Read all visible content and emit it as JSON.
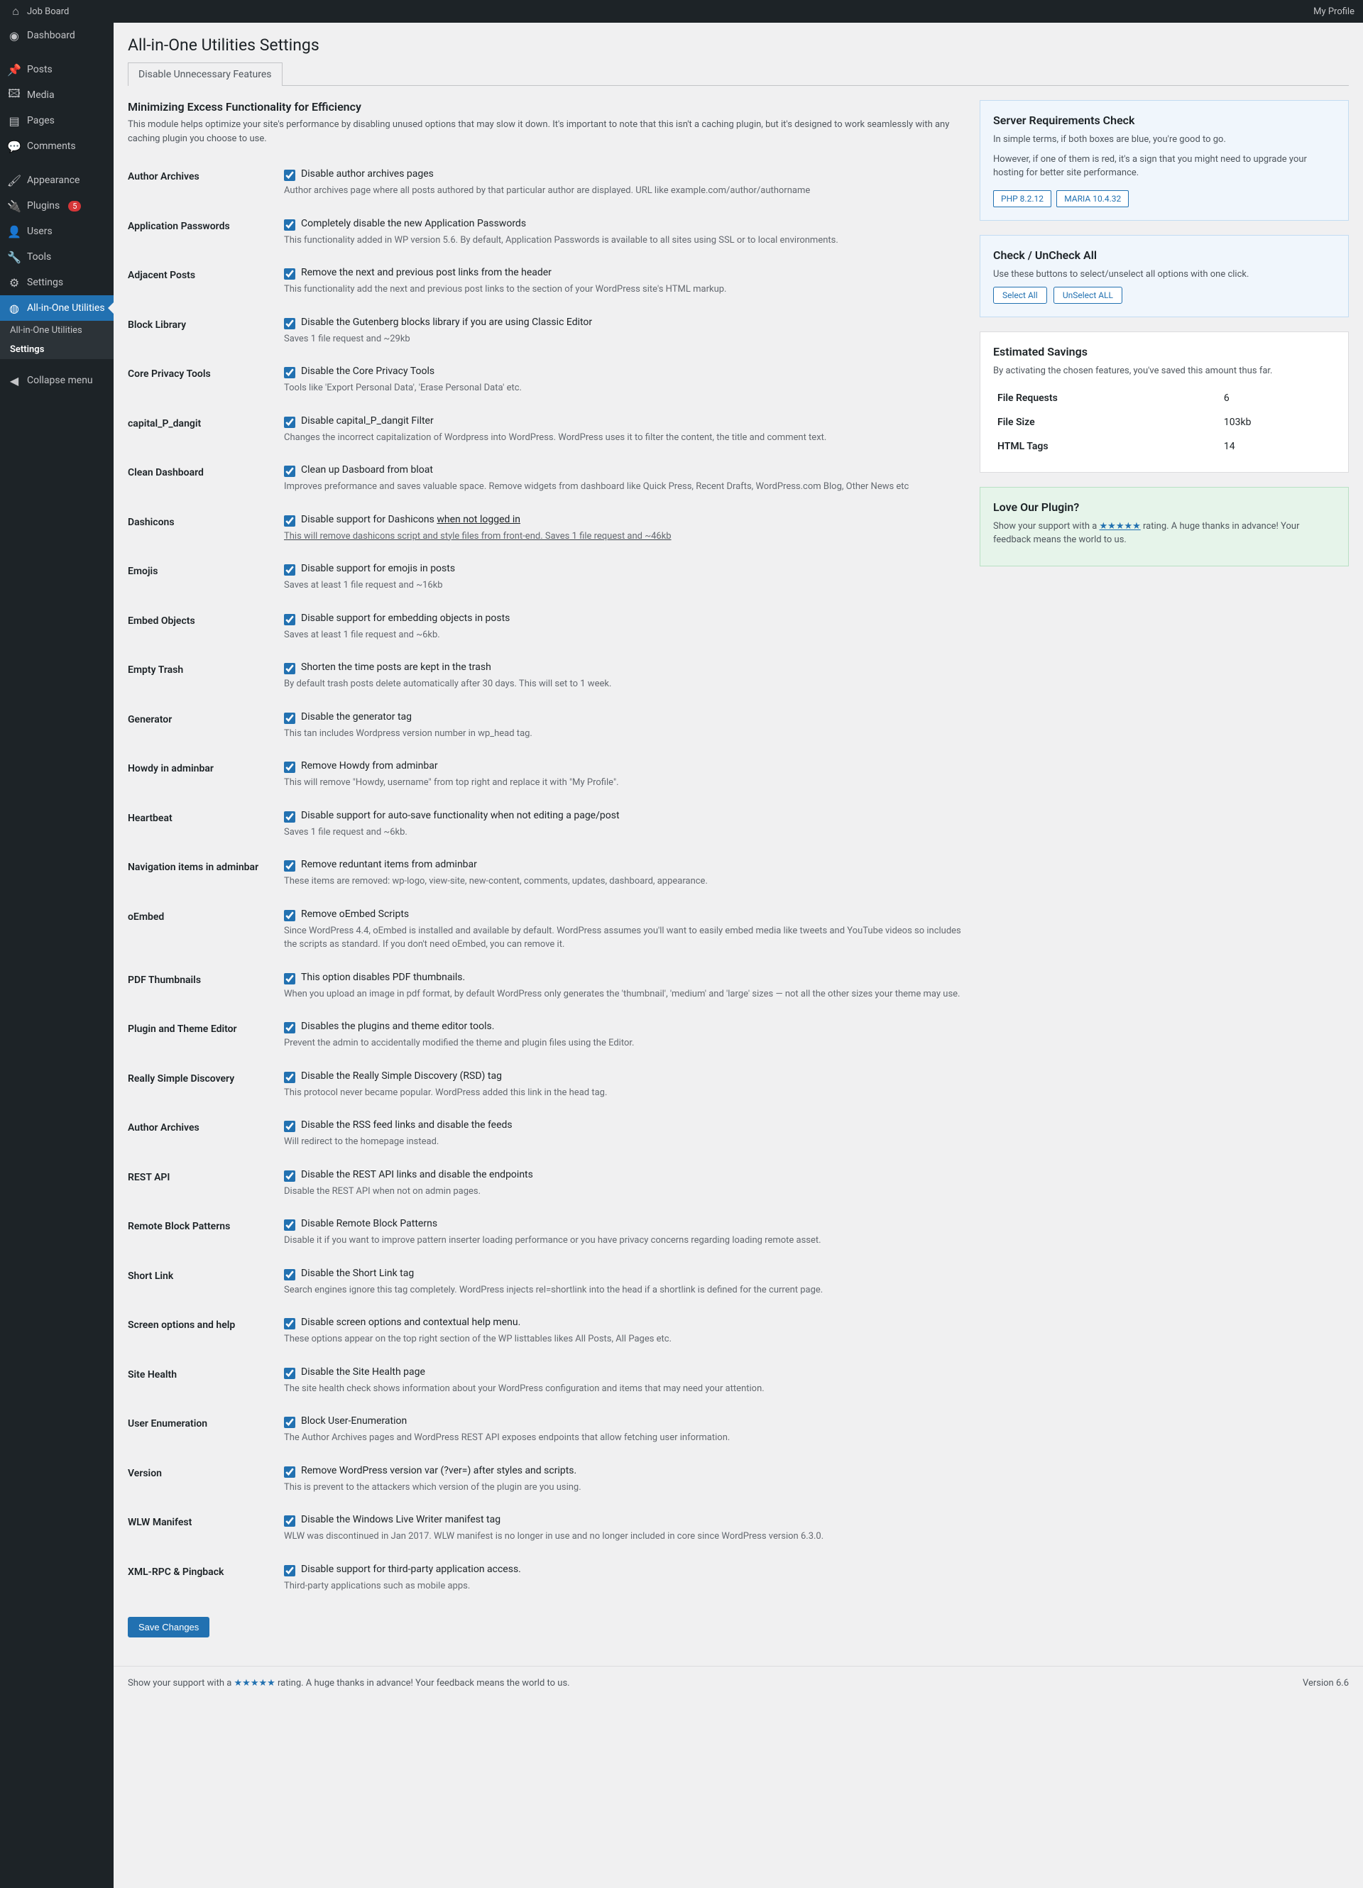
{
  "adminbar": {
    "site": "Job Board",
    "profile": "My Profile"
  },
  "menu": {
    "dashboard": "Dashboard",
    "posts": "Posts",
    "media": "Media",
    "pages": "Pages",
    "comments": "Comments",
    "appearance": "Appearance",
    "plugins": "Plugins",
    "plugins_count": "5",
    "users": "Users",
    "tools": "Tools",
    "settings": "Settings",
    "aio": "All-in-One Utilities",
    "sub_aio": "All-in-One Utilities",
    "sub_settings": "Settings",
    "collapse": "Collapse menu"
  },
  "page": {
    "title": "All-in-One Utilities Settings",
    "tab": "Disable Unnecessary Features",
    "intro_h": "Minimizing Excess Functionality for Efficiency",
    "intro_p": "This module helps optimize your site's performance by disabling unused options that may slow it down. It's important to note that this isn't a caching plugin, but it's designed to work seamlessly with any caching plugin you choose to use.",
    "save": "Save Changes"
  },
  "opts": [
    {
      "th": "Author Archives",
      "lbl": "Disable author archives pages",
      "desc": "Author archives page where all posts authored by that particular author are displayed. URL like example.com/author/authorname"
    },
    {
      "th": "Application Passwords",
      "lbl": "Completely disable the new Application Passwords",
      "desc": "This functionality added in WP version 5.6. By default, Application Passwords is available to all sites using SSL or to local environments."
    },
    {
      "th": "Adjacent Posts",
      "lbl": "Remove the next and previous post links from the header",
      "desc": "This functionality add the next and previous post links to the <head> section of your WordPress site's HTML markup."
    },
    {
      "th": "Block Library",
      "lbl": "Disable the Gutenberg blocks library if you are using Classic Editor",
      "desc": "Saves 1 file request and ~29kb"
    },
    {
      "th": "Core Privacy Tools",
      "lbl": "Disable the Core Privacy Tools",
      "desc": "Tools like 'Export Personal Data', 'Erase Personal Data' etc."
    },
    {
      "th": "capital_P_dangit",
      "lbl": "Disable capital_P_dangit Filter",
      "desc": "Changes the incorrect capitalization of Wordpress into WordPress. WordPress uses it to filter the content, the title and comment text."
    },
    {
      "th": "Clean Dashboard",
      "lbl": "Clean up Dasboard from bloat",
      "desc": "Improves preformance and saves valuable space. Remove widgets from dashboard like Quick Press, Recent Drafts, WordPress.com Blog, Other News etc"
    },
    {
      "th": "Dashicons",
      "lbl": "Disable support for Dashicons <u>when not logged in",
      "desc": "This will remove dashicons script and style files from front-end. Saves 1 file request and ~46kb"
    },
    {
      "th": "Emojis",
      "lbl": "Disable support for emojis in posts",
      "desc": "Saves at least 1 file request and ~16kb"
    },
    {
      "th": "Embed Objects",
      "lbl": "Disable support for embedding objects in posts",
      "desc": "Saves at least 1 file request and ~6kb."
    },
    {
      "th": "Empty Trash",
      "lbl": "Shorten the time posts are kept in the trash",
      "desc": "By default trash posts delete automatically after 30 days. This will set to 1 week."
    },
    {
      "th": "Generator",
      "lbl": "Disable the generator tag",
      "desc": "This tan includes Wordpress version number in wp_head tag."
    },
    {
      "th": "Howdy in adminbar",
      "lbl": "Remove Howdy from adminbar",
      "desc": "This will remove \"Howdy, username\" from top right and replace it with \"My Profile\"."
    },
    {
      "th": "Heartbeat",
      "lbl": "Disable support for auto-save functionality when not editing a page/post",
      "desc": "Saves 1 file request and ~6kb."
    },
    {
      "th": "Navigation items in adminbar",
      "lbl": "Remove reduntant items from adminbar",
      "desc": "These items are removed: wp-logo, view-site, new-content, comments, updates, dashboard, appearance."
    },
    {
      "th": "oEmbed",
      "lbl": "Remove oEmbed Scripts",
      "desc": "Since WordPress 4.4, oEmbed is installed and available by default. WordPress assumes you'll want to easily embed media like tweets and YouTube videos so includes the scripts as standard. If you don't need oEmbed, you can remove it."
    },
    {
      "th": "PDF Thumbnails",
      "lbl": "This option disables PDF thumbnails.",
      "desc": "When you upload an image in pdf format, by default WordPress only generates the 'thumbnail', 'medium' and 'large' sizes — not all the other sizes your theme may use."
    },
    {
      "th": "Plugin and Theme Editor",
      "lbl": "Disables the plugins and theme editor tools.",
      "desc": "Prevent the admin to accidentally modified the theme and plugin files using the Editor."
    },
    {
      "th": "Really Simple Discovery",
      "lbl": "Disable the Really Simple Discovery (RSD) tag",
      "desc": "This protocol never became popular. WordPress added this link in the head tag."
    },
    {
      "th": "Author Archives",
      "lbl": "Disable the RSS feed links and disable the feeds",
      "desc": "Will redirect to the homepage instead."
    },
    {
      "th": "REST API",
      "lbl": "Disable the REST API links and disable the endpoints",
      "desc": "Disable the REST API when not on admin pages."
    },
    {
      "th": "Remote Block Patterns",
      "lbl": "Disable Remote Block Patterns",
      "desc": "Disable it if you want to improve pattern inserter loading performance or you have privacy concerns regarding loading remote asset."
    },
    {
      "th": "Short Link",
      "lbl": "Disable the Short Link tag",
      "desc": "Search engines ignore this tag completely. WordPress injects rel=shortlink into the head if a shortlink is defined for the current page."
    },
    {
      "th": "Screen options and help",
      "lbl": "Disable screen options and contextual help menu.",
      "desc": "These options appear on the top right section of the WP listtables likes All Posts, All Pages etc."
    },
    {
      "th": "Site Health",
      "lbl": "Disable the Site Health page",
      "desc": "The site health check shows information about your WordPress configuration and items that may need your attention."
    },
    {
      "th": "User Enumeration",
      "lbl": "Block User-Enumeration",
      "desc": "The Author Archives pages and WordPress REST API exposes endpoints that allow fetching user information."
    },
    {
      "th": "Version",
      "lbl": "Remove WordPress version var (?ver=) after styles and scripts.",
      "desc": "This is prevent to the attackers which version of the plugin are you using."
    },
    {
      "th": "WLW Manifest",
      "lbl": "Disable the Windows Live Writer manifest tag",
      "desc": "WLW was discontinued in Jan 2017. WLW manifest is no longer in use and no longer included in core since WordPress version 6.3.0."
    },
    {
      "th": "XML-RPC & Pingback",
      "lbl": "Disable support for third-party application access.",
      "desc": "Third-party applications such as mobile apps."
    }
  ],
  "side": {
    "req_h": "Server Requirements Check",
    "req_p1": "In simple terms, if both boxes are blue, you're good to go.",
    "req_p2": "However, if one of them is red, it's a sign that you might need to upgrade your hosting for better site performance.",
    "req_php": "PHP 8.2.12",
    "req_db": "MARIA 10.4.32",
    "chk_h": "Check / UnCheck All",
    "chk_p": "Use these buttons to select/unselect all options with one click.",
    "sel": "Select All",
    "unsel": "UnSelect ALL",
    "sav_h": "Estimated Savings",
    "sav_p": "By activating the chosen features, you've saved this amount thus far.",
    "s1k": "File Requests",
    "s1v": "6",
    "s2k": "File Size",
    "s2v": "103kb",
    "s3k": "HTML Tags",
    "s3v": "14",
    "love_h": "Love Our Plugin?",
    "love_p1": "Show your support with a ",
    "love_stars": "★★★★★",
    "love_p2": " rating. A huge thanks in advance! Your feedback means the world to us."
  },
  "footer": {
    "left1": "Show your support with a ",
    "stars": "★★★★★",
    "left2": " rating. A huge thanks in advance! Your feedback means the world to us.",
    "version": "Version 6.6"
  }
}
